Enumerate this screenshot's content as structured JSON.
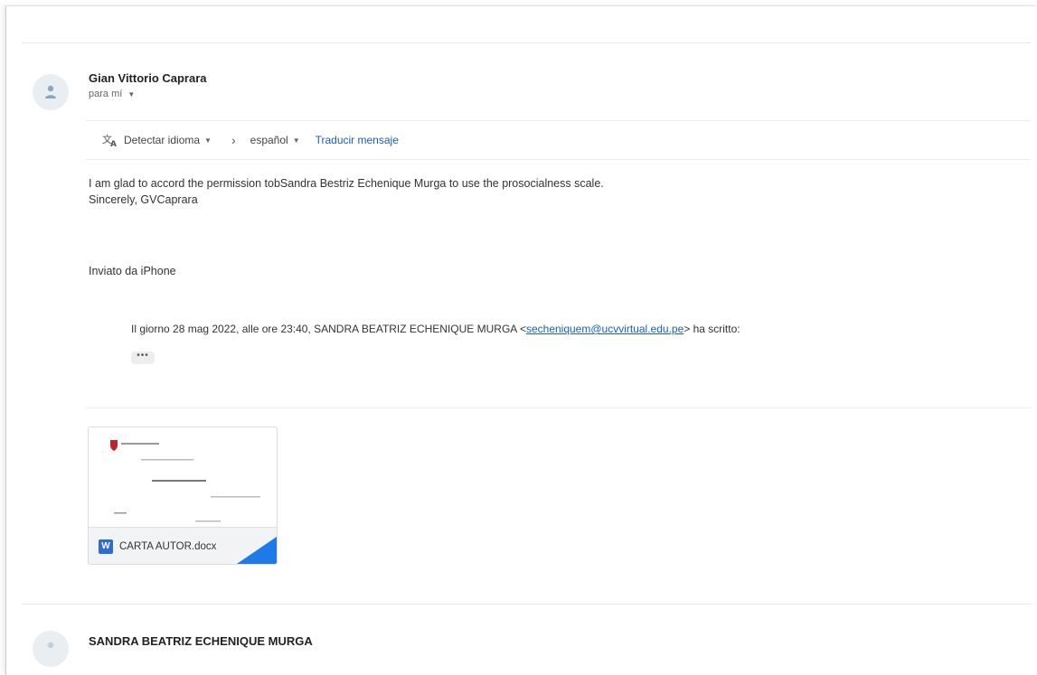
{
  "message": {
    "sender_name": "Gian Vittorio Caprara",
    "recipient_label": "para mí",
    "translate_bar": {
      "source_language": "Detectar idioma",
      "target_language": "español",
      "translate_action": "Traducir mensaje"
    },
    "body_lines": [
      "I am glad to accord the permission tobSandra Bestriz Echenique Murga to use the prosocialness scale.",
      "Sincerely, GVCaprara"
    ],
    "signature": "Inviato da iPhone",
    "quoted_header": {
      "prefix": "Il giorno 28 mag 2022, alle ore 23:40, SANDRA BEATRIZ ECHENIQUE MURGA <",
      "email": "secheniquem@ucvvirtual.edu.pe",
      "suffix": "> ha scritto:"
    },
    "show_trimmed_label": "•••",
    "attachment": {
      "icon_letter": "W",
      "file_name": "CARTA AUTOR.docx"
    }
  },
  "next_message": {
    "sender_name": "SANDRA BEATRIZ ECHENIQUE MURGA"
  },
  "colors": {
    "link": "#1a5ec4",
    "word_blue": "#2f6bd3",
    "seal_red": "#c0252b"
  }
}
